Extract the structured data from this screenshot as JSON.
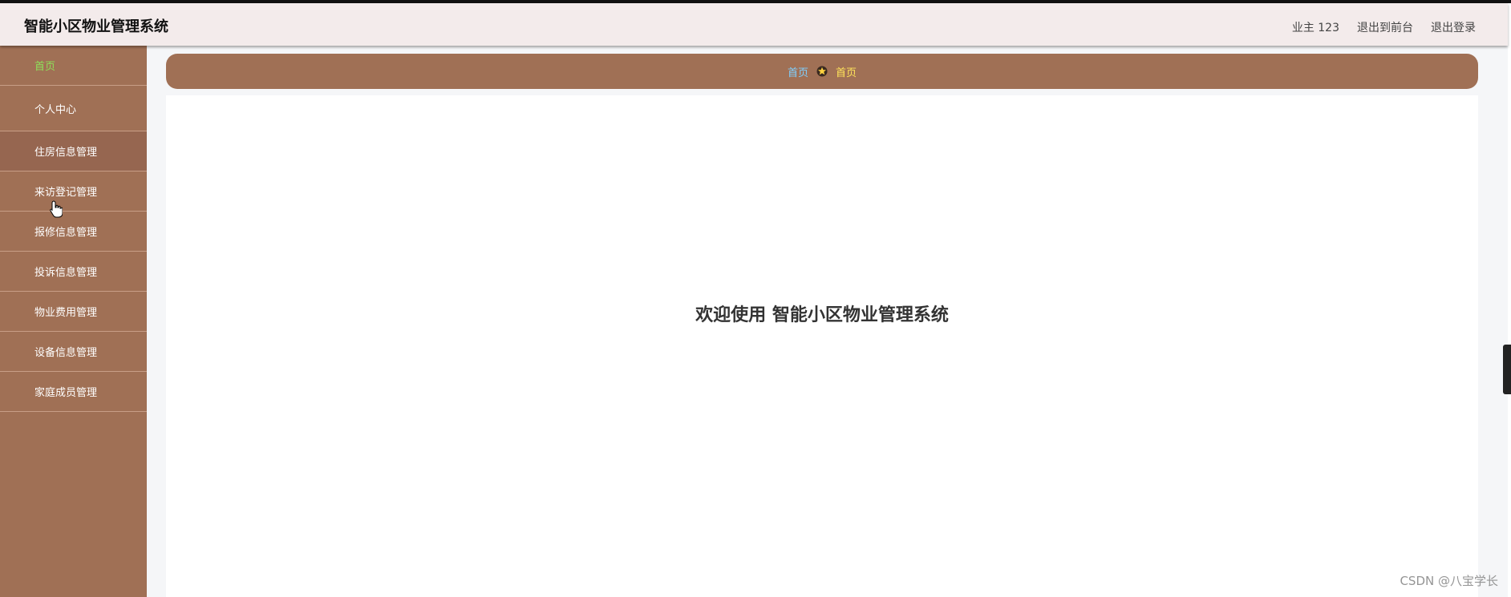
{
  "header": {
    "title": "智能小区物业管理系统",
    "user": "业主 123",
    "front_link": "退出到前台",
    "logout": "退出登录"
  },
  "sidebar": {
    "items": [
      {
        "label": "首页",
        "active": true
      },
      {
        "label": "个人中心"
      },
      {
        "label": "住房信息管理",
        "hover": true
      },
      {
        "label": "来访登记管理"
      },
      {
        "label": "报修信息管理"
      },
      {
        "label": "投诉信息管理"
      },
      {
        "label": "物业费用管理"
      },
      {
        "label": "设备信息管理"
      },
      {
        "label": "家庭成员管理"
      }
    ]
  },
  "breadcrumb": {
    "home": "首页",
    "current": "首页"
  },
  "main": {
    "welcome": "欢迎使用 智能小区物业管理系统"
  },
  "watermark": "CSDN @八宝学长",
  "colors": {
    "sidebar_bg": "#a07055",
    "active_text": "#8ee05a",
    "header_bg": "#f3ebeb"
  }
}
